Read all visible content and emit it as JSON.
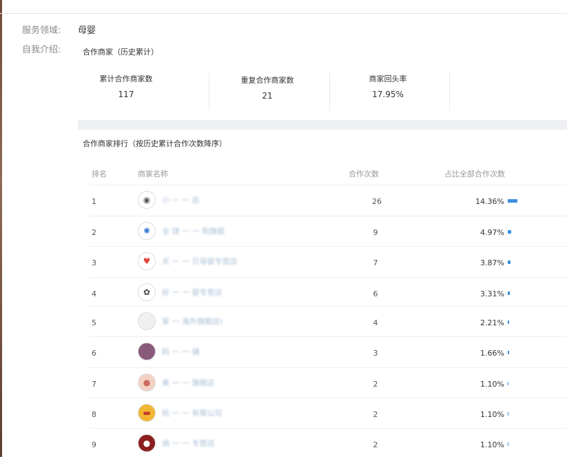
{
  "profile": {
    "service_label": "服务领域:",
    "service_value": "母婴",
    "intro_label": "自我介绍:"
  },
  "partners": {
    "title": "合作商家（历史累计）",
    "stats": [
      {
        "label": "累计合作商家数",
        "value": "117"
      },
      {
        "label": "重复合作商家数",
        "value": "21"
      },
      {
        "label": "商家回头率",
        "value": "17.95%"
      }
    ]
  },
  "ranking": {
    "title": "合作商家排行（按历史累计合作次数降序）",
    "columns": {
      "rank": "排名",
      "name": "商家名称",
      "count": "合作次数",
      "share": "占比全部合作次数"
    },
    "rows": [
      {
        "rank": "1",
        "name": "小 一 一 店",
        "count": "26",
        "share": "14.36%",
        "share_value": 14.36,
        "avatar": "baby-face-icon"
      },
      {
        "rank": "2",
        "name": "全 球 一 一 购旗舰",
        "count": "9",
        "share": "4.97%",
        "share_value": 4.97,
        "avatar": "colorful-badge-icon"
      },
      {
        "rank": "3",
        "name": "天 一 一 贝母婴专营店",
        "count": "7",
        "share": "3.87%",
        "share_value": 3.87,
        "avatar": "hello-kitty-icon"
      },
      {
        "rank": "4",
        "name": "好 一 一 婴专营店",
        "count": "6",
        "share": "3.31%",
        "share_value": 3.31,
        "avatar": "snoopy-icon"
      },
      {
        "rank": "5",
        "name": "家 一 海外旗舰店)",
        "count": "4",
        "share": "2.21%",
        "share_value": 2.21,
        "avatar": "blank-avatar-icon"
      },
      {
        "rank": "6",
        "name": "妈 一 一 铺",
        "count": "3",
        "share": "1.66%",
        "share_value": 1.66,
        "avatar": "child-photo-icon"
      },
      {
        "rank": "7",
        "name": "美 一 一 旗舰店",
        "count": "2",
        "share": "1.10%",
        "share_value": 1.1,
        "avatar": "baby-photo-icon"
      },
      {
        "rank": "8",
        "name": "杭 一 一 有限公司",
        "count": "2",
        "share": "1.10%",
        "share_value": 1.1,
        "avatar": "yellow-logo-icon"
      },
      {
        "rank": "9",
        "name": "俏 一 一 专营店",
        "count": "2",
        "share": "1.10%",
        "share_value": 1.1,
        "avatar": "red-logo-icon"
      }
    ]
  },
  "colors": {
    "bar": "#3d8fe0",
    "link": "#a9bfd6",
    "band": "#eef0f3"
  }
}
